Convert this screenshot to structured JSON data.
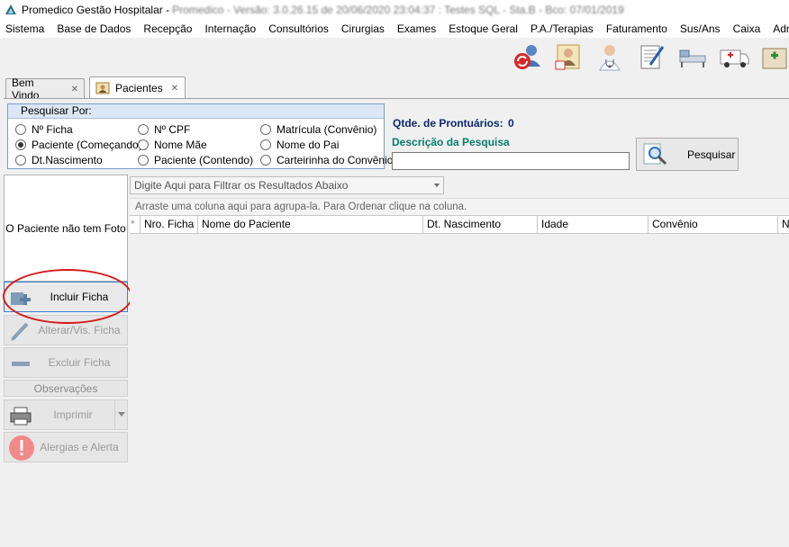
{
  "window": {
    "title": "Promedico Gestão Hospitalar -",
    "title_obscured": "Promedico - Versão: 3.0.26.15 de 20/06/2020 23:04:37 : Testes SQL - Sta.B - Bco: 07/01/2019"
  },
  "menu": [
    "Sistema",
    "Base de Dados",
    "Recepção",
    "Internação",
    "Consultórios",
    "Cirurgias",
    "Exames",
    "Estoque Geral",
    "P.A./Terapias",
    "Faturamento",
    "Sus/Ans",
    "Caixa",
    "Adminis"
  ],
  "toolbar_icons": [
    "refresh-users-icon",
    "patient-photo-icon",
    "doctor-icon",
    "document-pen-icon",
    "hospital-bed-icon",
    "ambulance-icon",
    "pharmacy-icon"
  ],
  "tabs": [
    {
      "label": "Bem Vindo",
      "close": "✕"
    },
    {
      "label": "Pacientes",
      "close": "✕"
    }
  ],
  "search": {
    "group_title": "Pesquisar Por:",
    "options": [
      "Nº Ficha",
      "Nº CPF",
      "Matrícula (Convênio)",
      "Paciente (Começando)",
      "Nome Mãe",
      "Nome do Pai",
      "Dt.Nascimento",
      "Paciente (Contendo)",
      "Carteirinha do Convênio"
    ],
    "selected": "Paciente (Começando)",
    "qtd_label": "Qtde. de Prontuários:",
    "qtd_value": "0",
    "desc_label": "Descrição da Pesquisa",
    "desc_value": "",
    "button_label": "Pesquisar"
  },
  "sidebar": {
    "photo_text": "O Paciente não tem Foto",
    "incluir": "Incluir Ficha",
    "alterar": "Alterar/Vis. Ficha",
    "excluir": "Excluir Ficha",
    "observacoes": "Observações",
    "imprimir": "Imprimir",
    "alergias": "Alergias e Alerta"
  },
  "grid": {
    "filter_placeholder": "Digite Aqui para Filtrar os Resultados Abaixo",
    "group_hint": "Arraste uma coluna aqui para agrupa-la. Para Ordenar clique na coluna.",
    "row_indicator": "*",
    "columns": [
      "Nro. Ficha",
      "Nome do Paciente",
      "Dt. Nascimento",
      "Idade",
      "Convênio",
      "N"
    ]
  },
  "colors": {
    "qtd_text": "#0b2a6b",
    "desc_text": "#0b7b6f",
    "highlight_ellipse": "#d61b1b",
    "group_header": "#dce7f5"
  }
}
